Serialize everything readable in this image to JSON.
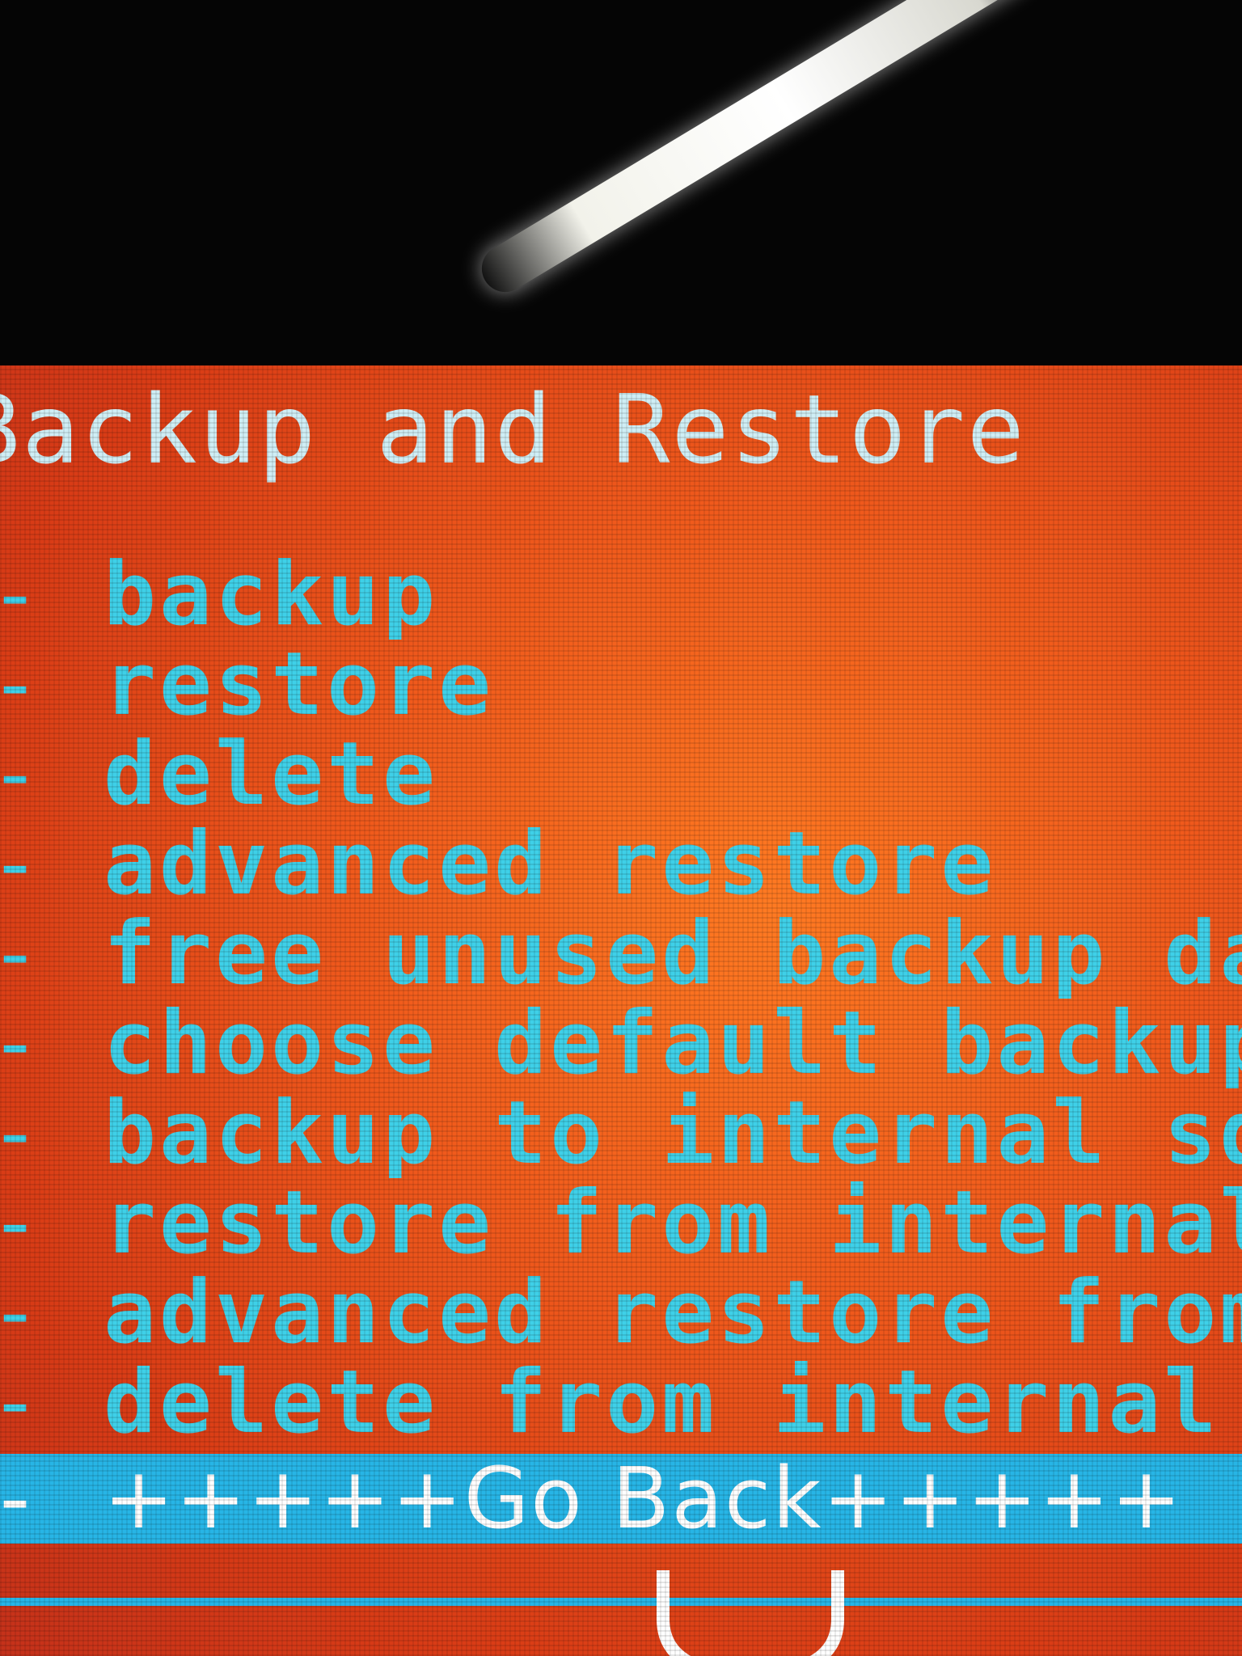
{
  "screen": {
    "title": "Backup and Restore",
    "menu_items": [
      {
        "prefix": "-",
        "label": "backup"
      },
      {
        "prefix": "-",
        "label": "restore"
      },
      {
        "prefix": "-",
        "label": "delete"
      },
      {
        "prefix": "-",
        "label": "advanced restore"
      },
      {
        "prefix": "-",
        "label": "free unused backup data"
      },
      {
        "prefix": "-",
        "label": "choose default backup format"
      },
      {
        "prefix": "-",
        "label": "backup to internal sdcard"
      },
      {
        "prefix": "-",
        "label": "restore from internal sdcard"
      },
      {
        "prefix": "-",
        "label": "advanced restore from internal sdcard"
      },
      {
        "prefix": "-",
        "label": "delete from internal sdcard"
      }
    ],
    "selected_item": {
      "prefix": "-",
      "label": "+++++Go Back+++++"
    }
  },
  "colors": {
    "background": "#e8481a",
    "text": "#3fd0e8",
    "highlight": "#27b5e6",
    "highlight_text": "#ffffff"
  },
  "icons": {
    "glare": "screen-glare",
    "bottom": "hook-icon"
  }
}
